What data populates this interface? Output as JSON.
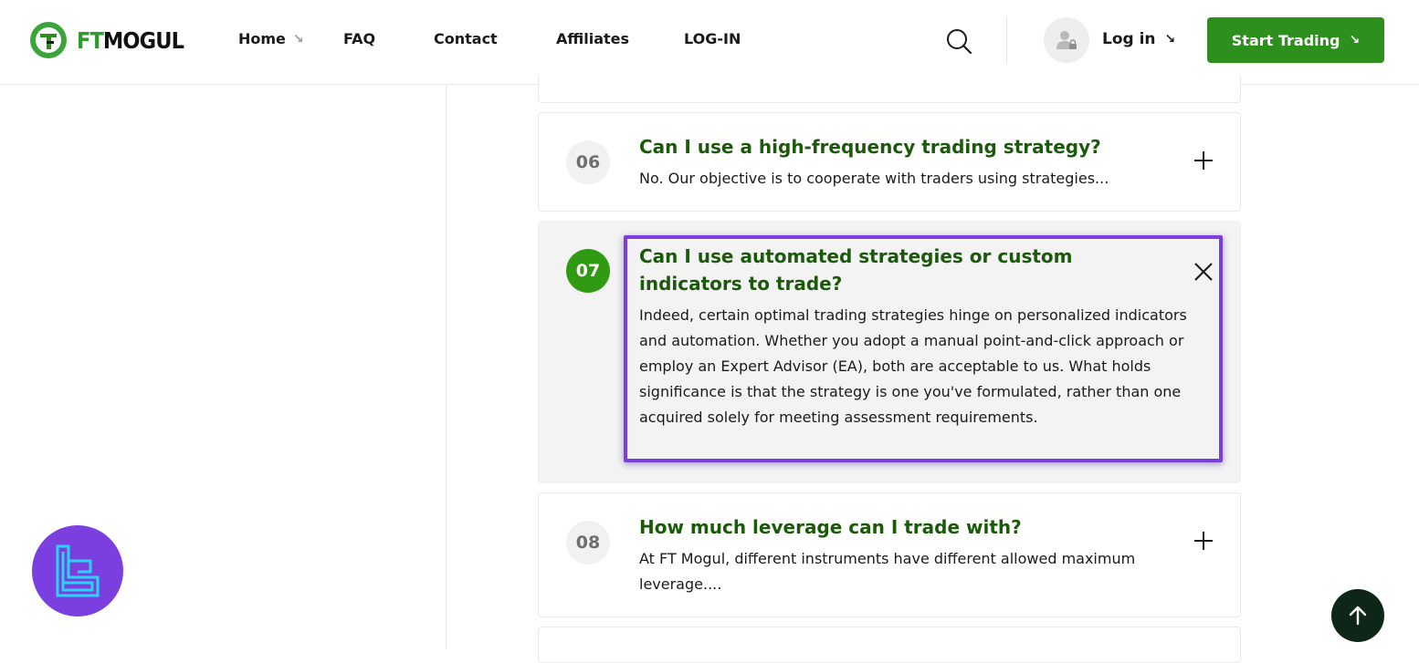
{
  "brand": {
    "ft": "FT",
    "mogul": "MOGUL",
    "accent": "#2f9a2f",
    "button_color": "#2d8f1c"
  },
  "nav": {
    "items": [
      {
        "label": "Home",
        "has_arrow": true
      },
      {
        "label": "FAQ"
      },
      {
        "label": "Contact"
      },
      {
        "label": "Affiliates"
      },
      {
        "label": "LOG-IN"
      }
    ],
    "login_label": "Log in",
    "start_label": "Start Trading",
    "arrow_glyph": "↘"
  },
  "faq": [
    {
      "number": "06",
      "question": "Can I use a high-frequency trading strategy?",
      "answer": "No. Our objective is to cooperate with traders using strategies...",
      "state": "collapsed"
    },
    {
      "number": "07",
      "question": "Can I use automated strategies or custom indicators to trade?",
      "answer": "Indeed, certain optimal trading strategies hinge on personalized indicators and automation. Whether you adopt a manual point-and-click approach or employ an Expert Advisor (EA), both are acceptable to us. What holds significance is that the strategy is one you've formulated, rather than one acquired solely for meeting assessment requirements.",
      "state": "expanded"
    },
    {
      "number": "08",
      "question": "How much leverage can I trade with?",
      "answer": "At FT Mogul, different instruments have different allowed maximum leverage....",
      "state": "collapsed"
    }
  ],
  "colors": {
    "highlight": "#7b3fe0",
    "question": "#1c5a0b",
    "active_number": "#2f9a12",
    "scroll_top": "#0d2617"
  }
}
